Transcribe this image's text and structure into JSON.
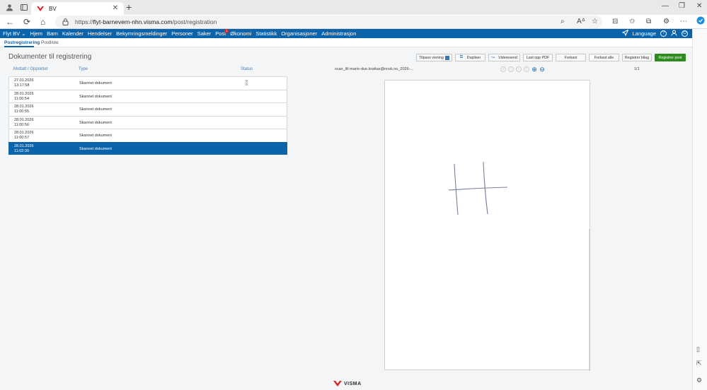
{
  "browser": {
    "tab_title": "BV",
    "url_prefix": "https://",
    "url_host": "flyt-barnevern-nhn.visma.com",
    "url_path": "/post/registration"
  },
  "nav": {
    "product": "Flyt BV",
    "items": [
      "Hjem",
      "Barn",
      "Kalender",
      "Hendelser",
      "Bekymringsmeldinger",
      "Personer",
      "Saker",
      "Post",
      "Økonomi",
      "Statistikk",
      "Organisasjoner",
      "Administrasjon"
    ],
    "post_badge": "1",
    "language": "Language"
  },
  "subnav": {
    "tabs": [
      "Postregistrering",
      "Postliste"
    ]
  },
  "page": {
    "title": "Dokumenter til registrering"
  },
  "table": {
    "headers": [
      "Mottatt / Opprettet",
      "Type",
      "Status"
    ],
    "rows": [
      {
        "date": "27.01.2026",
        "time": "13:17:58",
        "type": "Skannet dokument"
      },
      {
        "date": "28.01.2026",
        "time": "11:00:54",
        "type": "Skannet dokument"
      },
      {
        "date": "28.01.2026",
        "time": "11:00:55",
        "type": "Skannet dokument"
      },
      {
        "date": "28.01.2026",
        "time": "11:00:56",
        "type": "Skannet dokument"
      },
      {
        "date": "28.01.2026",
        "time": "11:00:57",
        "type": "Skannet dokument"
      },
      {
        "date": "28.01.2026",
        "time": "11:02:30",
        "type": "Skannet dokument"
      }
    ],
    "selected_row": 6
  },
  "toolbar": {
    "tilpass": "Tilpass visning",
    "dupliser": "Dupliser",
    "videresend": "Videresend",
    "last_opp": "Last opp PDF",
    "forkast": "Forkast",
    "forkast_alle": "Forkast alle",
    "registrer_bilag": "Registrer bilag",
    "registrer_post": "Registrer post"
  },
  "viewer": {
    "filename": "scan_lill-marie-due.brattas@nnsk.no_2026-...",
    "pages": "1/1"
  },
  "footer": {
    "brand": "VISMA"
  },
  "colors": {
    "brand_blue": "#0b64aa",
    "primary_green": "#2e8b1f",
    "badge_red": "#d9262c"
  }
}
